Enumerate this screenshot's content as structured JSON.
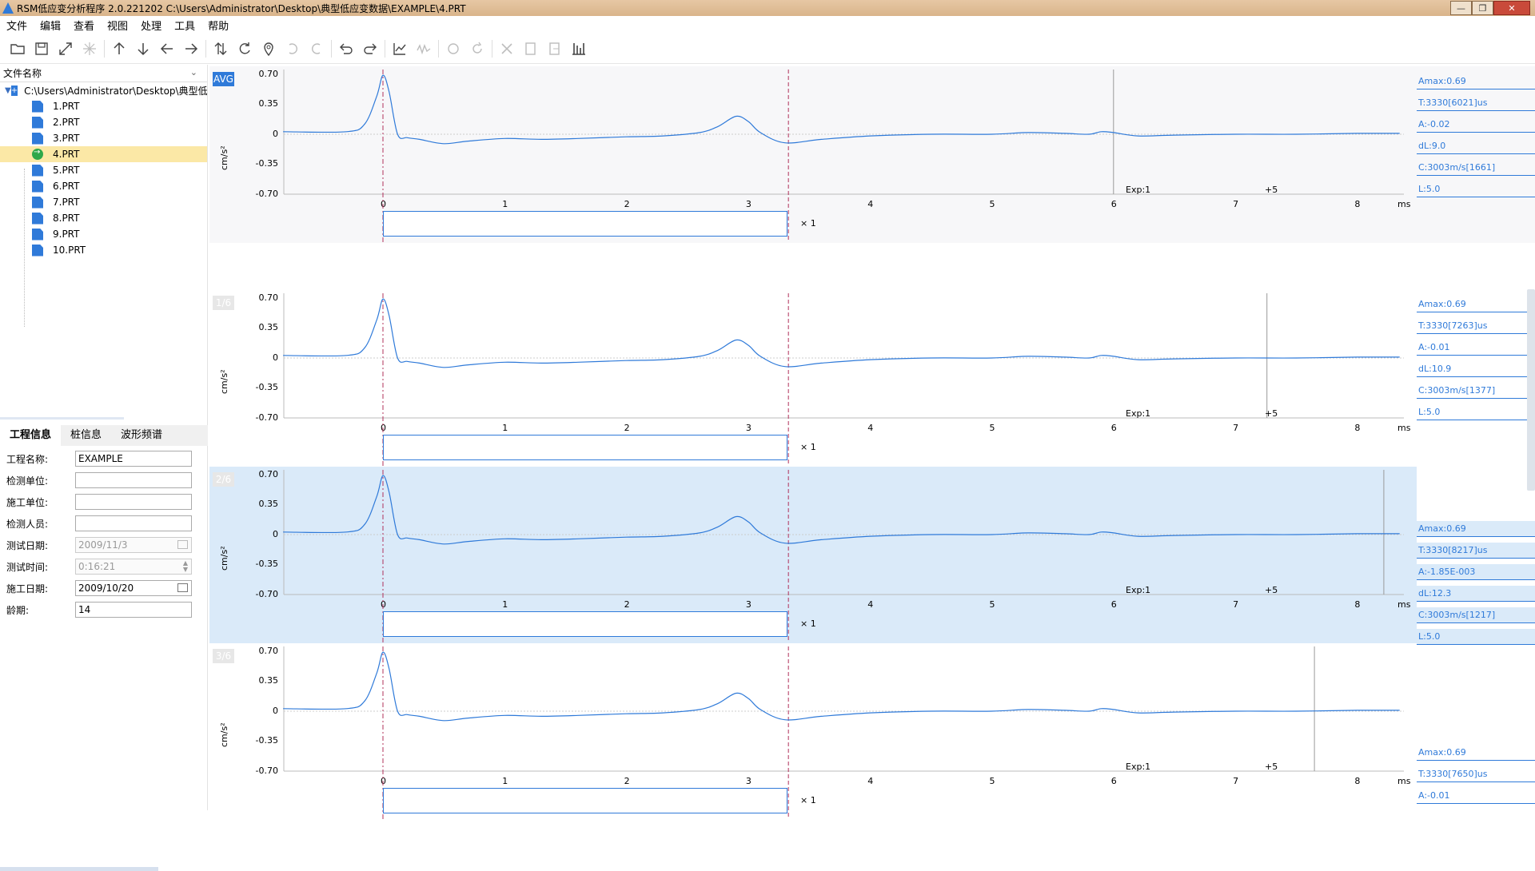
{
  "window": {
    "title": "RSM低应变分析程序 2.0.221202   C:\\Users\\Administrator\\Desktop\\典型低应变数据\\EXAMPLE\\4.PRT",
    "controls": [
      "—",
      "❐",
      "✕"
    ]
  },
  "menu": [
    "文件",
    "编辑",
    "查看",
    "视图",
    "处理",
    "工具",
    "帮助"
  ],
  "toolbar_icons": [
    {
      "name": "open-folder-icon",
      "enabled": true
    },
    {
      "name": "save-icon",
      "enabled": true
    },
    {
      "name": "expand-icon",
      "enabled": true
    },
    {
      "name": "star-icon",
      "enabled": false
    },
    {
      "name": "arrow-up-icon",
      "enabled": true
    },
    {
      "name": "arrow-down-icon",
      "enabled": true
    },
    {
      "name": "arrow-left-icon",
      "enabled": true
    },
    {
      "name": "arrow-right-icon",
      "enabled": true
    },
    {
      "name": "swap-vertical-icon",
      "enabled": true
    },
    {
      "name": "rotate-icon",
      "enabled": true
    },
    {
      "name": "location-pin-icon",
      "enabled": true
    },
    {
      "name": "undo-curve-icon",
      "enabled": false
    },
    {
      "name": "redo-curve-icon",
      "enabled": false
    },
    {
      "name": "undo-icon",
      "enabled": true
    },
    {
      "name": "redo-icon",
      "enabled": true
    },
    {
      "name": "line-chart-icon",
      "enabled": true
    },
    {
      "name": "wave-icon",
      "enabled": false
    },
    {
      "name": "refresh-icon",
      "enabled": false
    },
    {
      "name": "refresh-alt-icon",
      "enabled": false
    },
    {
      "name": "scissors-icon",
      "enabled": false
    },
    {
      "name": "export-icon",
      "enabled": false
    },
    {
      "name": "import-icon",
      "enabled": false
    },
    {
      "name": "bar-settings-icon",
      "enabled": true
    }
  ],
  "file_tree": {
    "header": "文件名称",
    "root": "C:\\Users\\Administrator\\Desktop\\典型低应变数据\\EXAMPLE",
    "files": [
      "1.PRT",
      "2.PRT",
      "3.PRT",
      "4.PRT",
      "5.PRT",
      "6.PRT",
      "7.PRT",
      "8.PRT",
      "9.PRT",
      "10.PRT"
    ],
    "selected": "4.PRT"
  },
  "info_tabs": [
    "工程信息",
    "桩信息",
    "波形频谱"
  ],
  "form": [
    {
      "label": "工程名称:",
      "value": "EXAMPLE",
      "disabled": false,
      "widget": ""
    },
    {
      "label": "检测单位:",
      "value": "",
      "disabled": false,
      "widget": ""
    },
    {
      "label": "施工单位:",
      "value": "",
      "disabled": false,
      "widget": ""
    },
    {
      "label": "检测人员:",
      "value": "",
      "disabled": false,
      "widget": ""
    },
    {
      "label": "测试日期:",
      "value": "2009/11/3",
      "disabled": true,
      "widget": "calendar"
    },
    {
      "label": "测试时间:",
      "value": "0:16:21",
      "disabled": true,
      "widget": "spin"
    },
    {
      "label": "施工日期:",
      "value": "2009/10/20",
      "disabled": false,
      "widget": "calendar"
    },
    {
      "label": "龄期:",
      "value": "14",
      "disabled": false,
      "widget": ""
    }
  ],
  "plot_axes": {
    "y_unit": "cm/s²",
    "y_ticks": [
      "0.70",
      "0.35",
      "0",
      "-0.35",
      "-0.70"
    ],
    "x_ticks": [
      "0",
      "1",
      "2",
      "3",
      "4",
      "5",
      "6",
      "7",
      "8"
    ],
    "x_unit": "ms",
    "multiplier": "× 1"
  },
  "panels": [
    {
      "badge": "AVG",
      "active_badge": true,
      "highlight": false,
      "exp": "Exp:1",
      "gain": "+5",
      "cursor_ms": 6.0,
      "params": [
        "Amax:0.69",
        "T:3330[6021]us",
        "A:-0.02",
        "dL:9.0",
        "C:3003m/s[1661]",
        "L:5.0"
      ]
    },
    {
      "badge": "1/6",
      "active_badge": false,
      "highlight": false,
      "exp": "Exp:1",
      "gain": "+5",
      "cursor_ms": 7.26,
      "params": [
        "Amax:0.69",
        "T:3330[7263]us",
        "A:-0.01",
        "dL:10.9",
        "C:3003m/s[1377]",
        "L:5.0"
      ]
    },
    {
      "badge": "2/6",
      "active_badge": false,
      "highlight": true,
      "exp": "Exp:1",
      "gain": "+5",
      "cursor_ms": 8.22,
      "params": [
        "Amax:0.69",
        "T:3330[8217]us",
        "A:-1.85E-003",
        "dL:12.3",
        "C:3003m/s[1217]",
        "L:5.0"
      ]
    },
    {
      "badge": "3/6",
      "active_badge": false,
      "highlight": false,
      "exp": "Exp:1",
      "gain": "+5",
      "cursor_ms": 7.65,
      "params": [
        "Amax:0.69",
        "T:3330[7650]us",
        "A:-0.01"
      ]
    }
  ],
  "colors": {
    "accent": "#2f7ad9",
    "highlight": "#daeaf9",
    "marker": "#b0305a"
  },
  "chart_data": {
    "type": "line",
    "title": "",
    "xlabel": "ms",
    "ylabel": "cm/s²",
    "xlim": [
      -0.82,
      8.35
    ],
    "ylim": [
      -0.7,
      0.7
    ],
    "markers_ms": [
      0,
      3.33
    ],
    "series": [
      {
        "x": [
          -0.82,
          -0.3,
          -0.15,
          -0.05,
          0.0,
          0.05,
          0.12,
          0.2,
          0.3,
          0.5,
          0.7,
          1.0,
          1.3,
          1.6,
          2.0,
          2.3,
          2.6,
          2.75,
          2.9,
          3.0,
          3.1,
          3.3,
          3.6,
          4.0,
          4.5,
          5.0,
          5.3,
          5.6,
          5.8,
          5.9,
          6.0,
          6.2,
          6.5,
          7.0,
          7.5,
          8.0,
          8.35
        ],
        "y": [
          0.03,
          0.03,
          0.12,
          0.45,
          0.69,
          0.5,
          0.0,
          -0.04,
          -0.06,
          -0.11,
          -0.08,
          -0.05,
          -0.06,
          -0.05,
          -0.03,
          -0.02,
          0.02,
          0.09,
          0.21,
          0.15,
          0.02,
          -0.1,
          -0.06,
          -0.02,
          0.0,
          0.0,
          0.02,
          0.01,
          0.0,
          0.03,
          0.02,
          -0.02,
          -0.01,
          0.0,
          0.0,
          0.01,
          0.01
        ]
      }
    ]
  }
}
